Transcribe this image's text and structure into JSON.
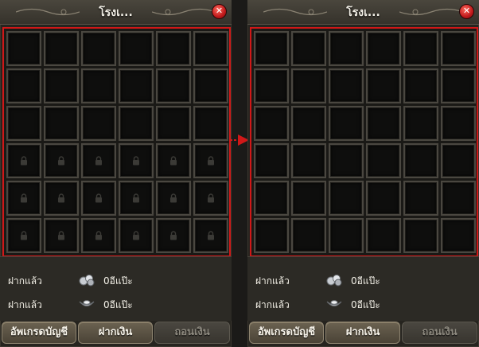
{
  "panels": [
    {
      "title": "โรงเ...",
      "close_symbol": "✕",
      "state": "before-upgrade",
      "grid": {
        "rows": 6,
        "columns": 6,
        "unlocked_rows": 3,
        "locked_rows": 3
      },
      "currency": [
        {
          "label": "ฝากแล้ว",
          "icon": "silver-coins-icon",
          "value": "0อีแป๊ะ"
        },
        {
          "label": "ฝากแล้ว",
          "icon": "silver-ingot-icon",
          "value": "0อีแป๊ะ"
        }
      ],
      "buttons": {
        "upgrade": "อัพเกรดบัญชี",
        "deposit": "ฝากเงิน",
        "withdraw": "ถอนเงิน"
      }
    },
    {
      "title": "โรงเ...",
      "close_symbol": "✕",
      "state": "after-upgrade",
      "grid": {
        "rows": 6,
        "columns": 6,
        "unlocked_rows": 6,
        "locked_rows": 0
      },
      "currency": [
        {
          "label": "ฝากแล้ว",
          "icon": "silver-coins-icon",
          "value": "0อีแป๊ะ"
        },
        {
          "label": "ฝากแล้ว",
          "icon": "silver-ingot-icon",
          "value": "0อีแป๊ะ"
        }
      ],
      "buttons": {
        "upgrade": "อัพเกรดบัญชี",
        "deposit": "ฝากเงิน",
        "withdraw": "ถอนเงิน"
      }
    }
  ],
  "highlight_color": "#d01818",
  "transition_arrow_icon": "right-arrow-icon",
  "disabled_button": "withdraw"
}
